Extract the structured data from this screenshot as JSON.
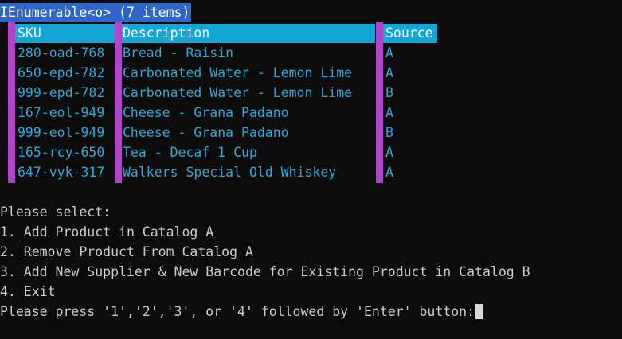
{
  "result_header": "IEnumerable<o> (7 items)",
  "table": {
    "columns": [
      "SKU",
      "Description",
      "Source"
    ],
    "rows": [
      [
        "280-oad-768",
        "Bread - Raisin",
        "A"
      ],
      [
        "650-epd-782",
        "Carbonated Water - Lemon Lime",
        "A"
      ],
      [
        "999-epd-782",
        "Carbonated Water - Lemon Lime",
        "B"
      ],
      [
        "167-eol-949",
        "Cheese - Grana Padano",
        "A"
      ],
      [
        "999-eol-949",
        "Cheese - Grana Padano",
        "B"
      ],
      [
        "165-rcy-650",
        "Tea - Decaf 1 Cup",
        "A"
      ],
      [
        "647-vyk-317",
        "Walkers Special Old Whiskey",
        "A"
      ]
    ]
  },
  "menu": {
    "prompt": "Please select:",
    "options": [
      "1. Add Product in Catalog A",
      "2. Remove Product From Catalog A",
      "3. Add New Supplier & New Barcode for Existing Product in Catalog B",
      "4. Exit"
    ],
    "instruction": "Please press '1','2','3', or '4' followed by 'Enter' button:"
  },
  "colors": {
    "background": "#0c0c0c",
    "title_highlight": "#2f67c9",
    "table_header": "#16a6d6",
    "table_separator": "#b145c9",
    "table_text": "#2fa6dc",
    "console_text": "#cccccc"
  }
}
